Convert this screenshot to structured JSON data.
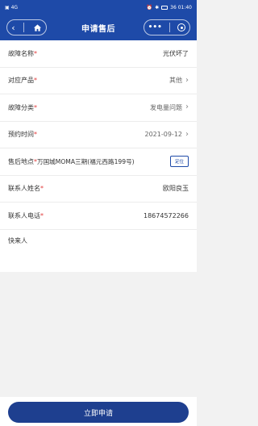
{
  "status_bar": {
    "left_text": "▣ 4G",
    "right_text": "36 01:40"
  },
  "nav": {
    "title": "申请售后",
    "more_glyph": "•••"
  },
  "form": {
    "fault_name": {
      "label": "故障名称",
      "value": "光伏坏了"
    },
    "product": {
      "label": "对应产品",
      "value": "其他"
    },
    "fault_category": {
      "label": "故障分类",
      "value": "发电量问题"
    },
    "appointment_time": {
      "label": "预约时间",
      "value": "2021-09-12"
    },
    "service_location": {
      "label": "售后地点",
      "value": "万国城MOMA三期(福元西路199号)",
      "locate_label": "定位"
    },
    "contact_name": {
      "label": "联系人姓名",
      "value": "欧阳良玉"
    },
    "contact_phone": {
      "label": "联系人电话",
      "value": "18674572266"
    },
    "courier": {
      "label": "快来人",
      "value": ""
    }
  },
  "submit_label": "立即申请"
}
